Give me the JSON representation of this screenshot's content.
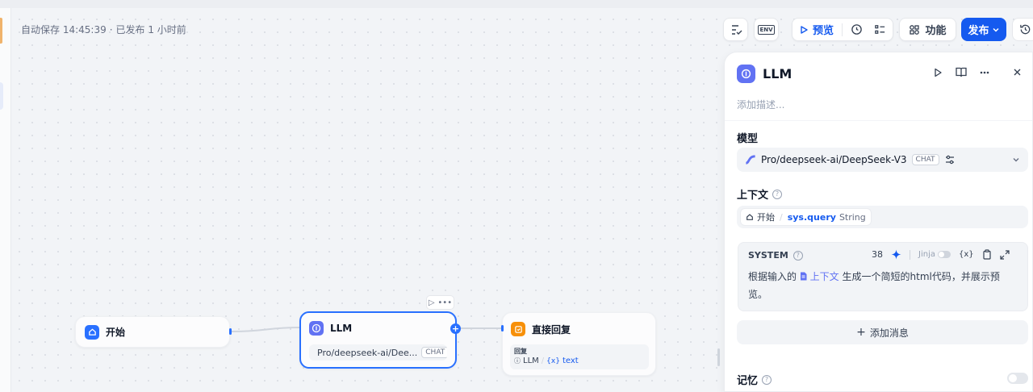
{
  "header": {
    "autosave_text": "自动保存 14:45:39",
    "separator": "·",
    "published_text": "已发布 1 小时前"
  },
  "toolbar": {
    "env_label": "ENV",
    "preview_label": "预览",
    "features_label": "功能",
    "publish_label": "发布"
  },
  "nodes": {
    "start": {
      "title": "开始"
    },
    "llm": {
      "title": "LLM",
      "model": "Pro/deepseek-ai/Dee...",
      "model_badge": "CHAT"
    },
    "answer": {
      "title": "直接回复",
      "field_label": "回复",
      "ref_node": "LLM",
      "ref_var": "text",
      "ref_var_icon": "{x}"
    }
  },
  "panel": {
    "title": "LLM",
    "description_placeholder": "添加描述...",
    "model_label": "模型",
    "model_name": "Pro/deepseek-ai/DeepSeek-V3",
    "model_badge": "CHAT",
    "context_label": "上下文",
    "context_node": "开始",
    "context_var": "sys.query",
    "context_type": "String",
    "system_label": "SYSTEM",
    "token_count": "38",
    "jinja_label": "Jinja",
    "var_icon_text": "{x}",
    "prompt_prefix": "根据输入的",
    "prompt_ref": "上下文",
    "prompt_suffix": "生成一个简短的html代码，并展示预览。",
    "add_message_label": "添加消息",
    "memory_label": "记忆"
  },
  "icons": [
    "close-icon",
    "play-icon",
    "book-icon",
    "more-icon",
    "chevron-down-icon",
    "sliders-icon",
    "help-icon",
    "sparkle-icon",
    "copy-icon",
    "expand-icon",
    "plus-icon",
    "history-icon",
    "home-icon",
    "llm-node-icon",
    "reply-icon"
  ],
  "colors": {
    "accent": "#155aef",
    "node_blue": "#2970ff",
    "node_indigo": "#6172f3",
    "node_orange": "#f79009"
  }
}
